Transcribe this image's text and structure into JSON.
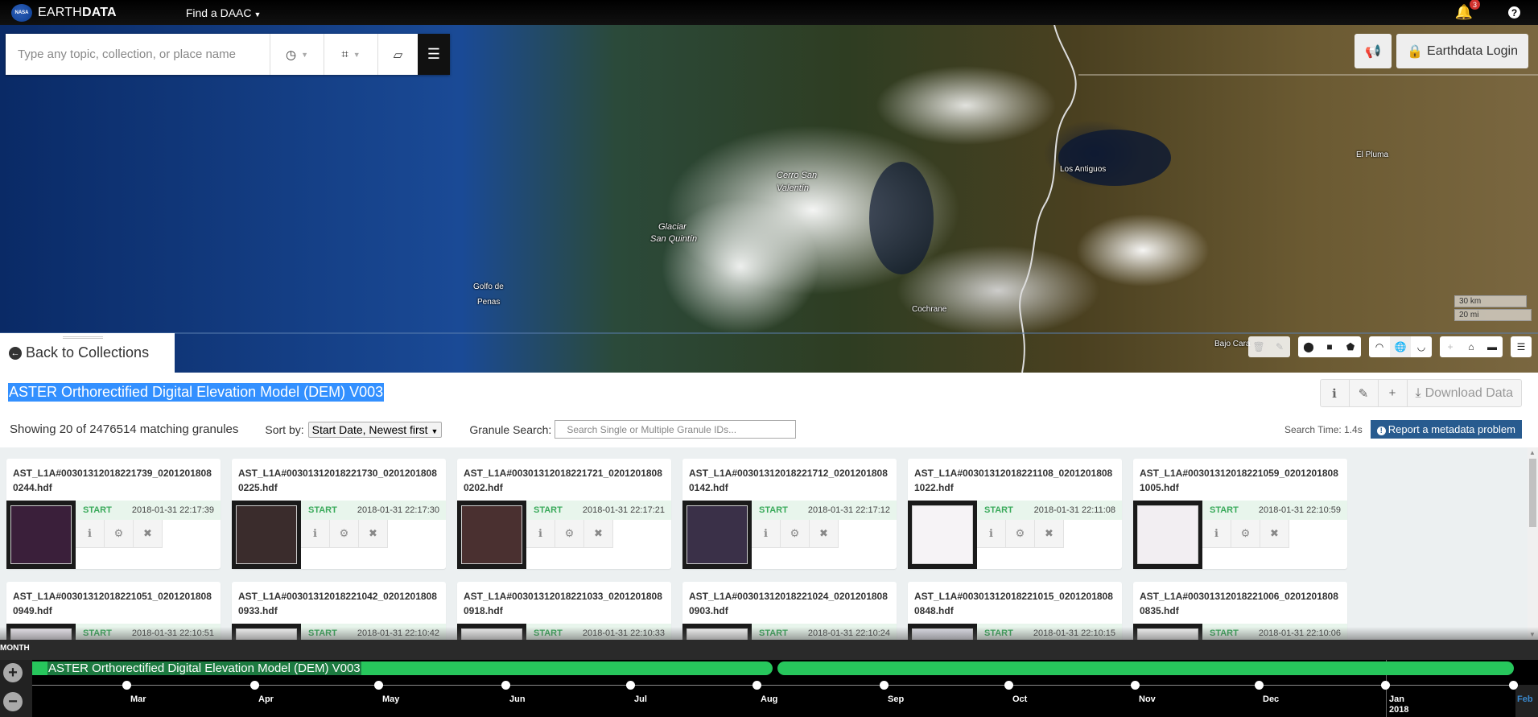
{
  "nav": {
    "logo_text": "NASA",
    "brand_light": "EARTH",
    "brand_bold": "DATA",
    "find_daac": "Find a DAAC",
    "notification_count": "3",
    "help_glyph": "?"
  },
  "search": {
    "placeholder": "Type any topic, collection, or place name",
    "value": "",
    "temporal_icon": "clock-icon",
    "spatial_icon": "crop-icon",
    "clear_icon": "eraser-icon",
    "menu_icon": "hamburger-icon"
  },
  "map": {
    "login_label": "Earthdata Login",
    "labels": [
      {
        "text": "Cerro San",
        "italic": true
      },
      {
        "text": "Valentín",
        "italic": true
      },
      {
        "text": "Glaciar",
        "italic": true
      },
      {
        "text": "San Quintín",
        "italic": true
      },
      {
        "text": "Golfo de",
        "italic": false
      },
      {
        "text": "Penas",
        "italic": false
      },
      {
        "text": "Los Antiguos",
        "italic": false
      },
      {
        "text": "El Pluma",
        "italic": false
      },
      {
        "text": "Cochrane",
        "italic": false
      },
      {
        "text": "Bajo Cara",
        "italic": false
      }
    ],
    "scale_km": "30 km",
    "scale_mi": "20 mi",
    "back_label": "Back to Collections"
  },
  "collection": {
    "title": "ASTER Orthorectified Digital Elevation Model (DEM) V003",
    "download_label": "Download Data",
    "showing_text": "Showing 20 of 2476514 matching granules",
    "sort_label": "Sort by:",
    "sort_value": "Start Date, Newest first",
    "granule_search_label": "Granule Search:",
    "granule_search_placeholder": "Search Single or Multiple Granule IDs...",
    "search_time": "Search Time: 1.4s",
    "report_label": "Report a metadata problem"
  },
  "granules": [
    {
      "name": "AST_L1A#00301312018221739_02012018080244.hdf",
      "start_label": "START",
      "start": "2018-01-31 22:17:39",
      "thumb": "#3a1f3a"
    },
    {
      "name": "AST_L1A#00301312018221730_02012018080225.hdf",
      "start_label": "START",
      "start": "2018-01-31 22:17:30",
      "thumb": "#3a2c2c"
    },
    {
      "name": "AST_L1A#00301312018221721_02012018080202.hdf",
      "start_label": "START",
      "start": "2018-01-31 22:17:21",
      "thumb": "#4a3030"
    },
    {
      "name": "AST_L1A#00301312018221712_02012018080142.hdf",
      "start_label": "START",
      "start": "2018-01-31 22:17:12",
      "thumb": "#3a3048"
    },
    {
      "name": "AST_L1A#00301312018221108_02012018081022.hdf",
      "start_label": "START",
      "start": "2018-01-31 22:11:08",
      "thumb": "#f6f3f6"
    },
    {
      "name": "AST_L1A#00301312018221059_02012018081005.hdf",
      "start_label": "START",
      "start": "2018-01-31 22:10:59",
      "thumb": "#f2eef2"
    },
    {
      "name": "AST_L1A#00301312018221051_02012018080949.hdf",
      "start_label": "START",
      "start": "2018-01-31 22:10:51",
      "thumb": "#e8e4ec"
    },
    {
      "name": "AST_L1A#00301312018221042_02012018080933.hdf",
      "start_label": "START",
      "start": "2018-01-31 22:10:42",
      "thumb": "#f4f4f4"
    },
    {
      "name": "AST_L1A#00301312018221033_02012018080918.hdf",
      "start_label": "START",
      "start": "2018-01-31 22:10:33",
      "thumb": "#eeeeee"
    },
    {
      "name": "AST_L1A#00301312018221024_02012018080903.hdf",
      "start_label": "START",
      "start": "2018-01-31 22:10:24",
      "thumb": "#f4f4f4"
    },
    {
      "name": "AST_L1A#00301312018221015_02012018080848.hdf",
      "start_label": "START",
      "start": "2018-01-31 22:10:15",
      "thumb": "#dcdce6"
    },
    {
      "name": "AST_L1A#00301312018221006_02012018080835.hdf",
      "start_label": "START",
      "start": "2018-01-31 22:10:06",
      "thumb": "#f4f4f4"
    }
  ],
  "timeline": {
    "zoom_level": "MONTH",
    "collection_label": "ASTER Orthorectified Digital Elevation Model (DEM) V003",
    "ticks": [
      "Mar",
      "Apr",
      "May",
      "Jun",
      "Jul",
      "Aug",
      "Sep",
      "Oct",
      "Nov",
      "Dec",
      "Jan",
      "Feb"
    ],
    "year_label": "2018",
    "colors": {
      "bar": "#27c65c",
      "bar_label_bg": "#1c7a40",
      "future_tick": "#3a8ad0"
    }
  },
  "colors": {
    "selection": "#3390ff",
    "report_button": "#285b8f",
    "start_label": "#3aaa5b",
    "start_row_bg": "#e8f5ec"
  }
}
